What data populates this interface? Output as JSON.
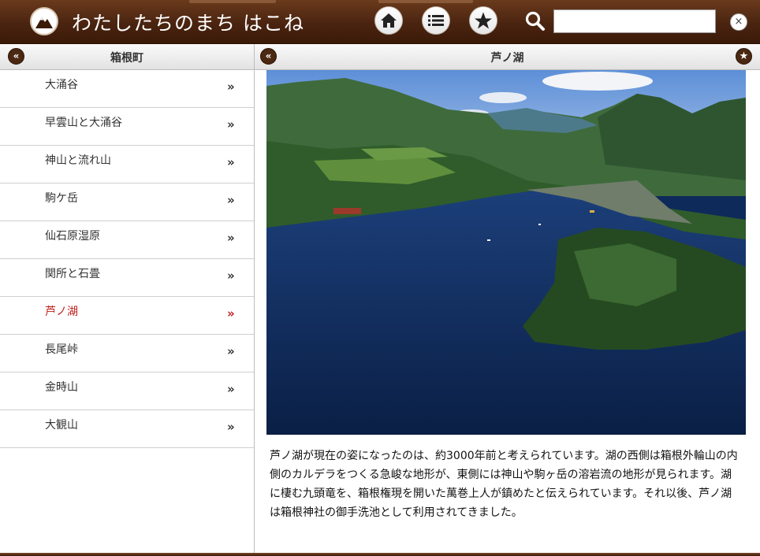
{
  "header": {
    "app_title": "わたしたちのまち はこね",
    "search": {
      "value": "",
      "placeholder": ""
    },
    "buttons": {
      "home_icon": "home-icon",
      "list_icon": "list-icon",
      "star_icon": "star-icon"
    },
    "clear_label": "×"
  },
  "left_panel": {
    "title": "箱根町",
    "back_label": "«",
    "items": [
      {
        "label": "大涌谷",
        "active": false
      },
      {
        "label": "早雲山と大涌谷",
        "active": false
      },
      {
        "label": "神山と流れ山",
        "active": false
      },
      {
        "label": "駒ケ岳",
        "active": false
      },
      {
        "label": "仙石原湿原",
        "active": false
      },
      {
        "label": "関所と石畳",
        "active": false
      },
      {
        "label": "芦ノ湖",
        "active": true
      },
      {
        "label": "長尾峠",
        "active": false
      },
      {
        "label": "金時山",
        "active": false
      },
      {
        "label": "大観山",
        "active": false
      }
    ],
    "chevron": "»"
  },
  "right_panel": {
    "title": "芦ノ湖",
    "back_label": "«",
    "favorite_label": "★",
    "description": "芦ノ湖が現在の姿になったのは、約3000年前と考えられています。湖の西側は箱根外輪山の内側のカルデラをつくる急峻な地形が、東側には神山や駒ヶ岳の溶岩流の地形が見られます。湖に棲む九頭竜を、箱根権現を開いた萬巻上人が鎮めたと伝えられています。それ以後、芦ノ湖は箱根神社の御手洗池として利用されてきました。"
  },
  "colors": {
    "header_brown": "#4a2410",
    "active_red": "#c0201c",
    "lake_blue": "#0e2a5a"
  }
}
